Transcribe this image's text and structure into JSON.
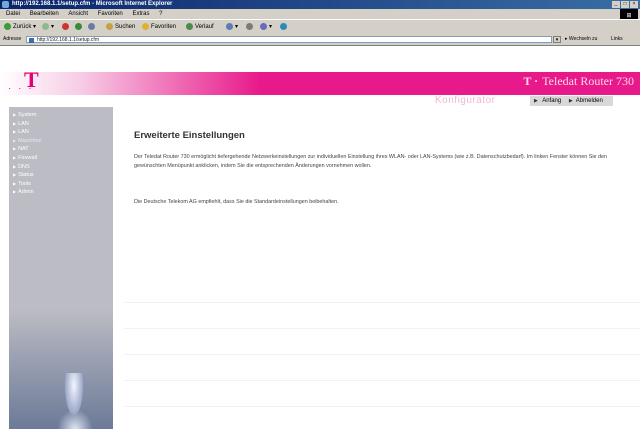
{
  "window": {
    "title": "http://192.168.1.1/setup.cfm - Microsoft Internet Explorer"
  },
  "menubar": {
    "items": [
      "Datei",
      "Bearbeiten",
      "Ansicht",
      "Favoriten",
      "Extras",
      "?"
    ]
  },
  "toolbar": {
    "back": "Zurück",
    "search": "Suchen",
    "favorites": "Favoriten",
    "history": "Verlauf"
  },
  "addressbar": {
    "label": "Adresse",
    "url": "http://192.168.1.1/setup.cfm",
    "go": "Wechseln zu",
    "links": "Links"
  },
  "brand": {
    "logo": "T",
    "dots": "· · ·",
    "product": "Teledat Router 730",
    "section": "Konfigurator"
  },
  "topnav": {
    "items": [
      "Anfang",
      "Abmelden"
    ]
  },
  "sidebar": {
    "items": [
      {
        "label": "System"
      },
      {
        "label": "LAN"
      },
      {
        "label": "LAN"
      },
      {
        "label": "Maschine"
      },
      {
        "label": "NAT"
      },
      {
        "label": "Firewall"
      },
      {
        "label": "DNS"
      },
      {
        "label": "Status"
      },
      {
        "label": "Tools"
      },
      {
        "label": "Admin"
      }
    ]
  },
  "main": {
    "title": "Erweiterte Einstellungen",
    "paragraph1": "Der Teledat Router 730 ermöglicht tiefergehende Netzwerkeinstellungen zur individuellen Einstellung ihres WLAN- oder LAN-Systems (wie z.B. Datenschutzbedarf). Im linken Fenster können Sie den gewünschten Menüpunkt anklicken, indem Sie die entsprechenden Änderungen vornehmen wollen.",
    "paragraph2": "Die Deutsche Telekom AG empfiehlt, dass Sie die Standardeinstellungen beibehalten."
  }
}
